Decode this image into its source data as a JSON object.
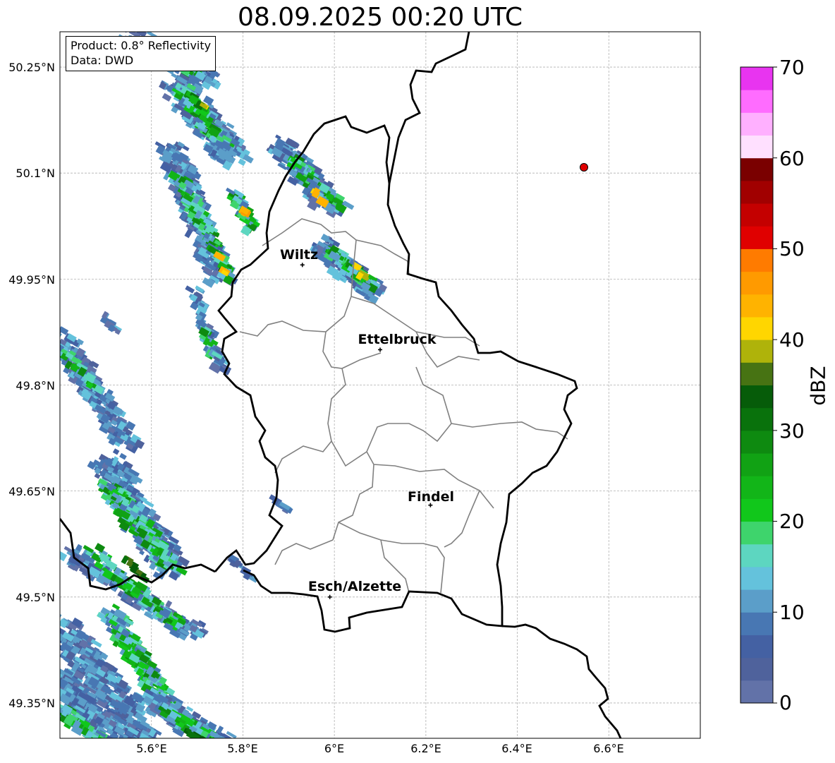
{
  "title": "08.09.2025 00:20 UTC",
  "info": {
    "product": "Product: 0.8° Reflectivity",
    "data": "Data: DWD"
  },
  "map": {
    "extent_lon": [
      5.4,
      6.8
    ],
    "extent_lat": [
      49.3,
      50.3
    ],
    "lat_ticks": [
      "50.25°N",
      "50.1°N",
      "49.95°N",
      "49.8°N",
      "49.65°N",
      "49.5°N",
      "49.35°N"
    ],
    "lon_ticks": [
      "5.6°E",
      "5.8°E",
      "6°E",
      "6.2°E",
      "6.4°E",
      "6.6°E"
    ],
    "radar_site_color": "#e00000",
    "cities": [
      {
        "name": "Wiltz",
        "lon": 5.93,
        "lat": 49.97
      },
      {
        "name": "Ettelbruck",
        "lon": 6.1,
        "lat": 49.85
      },
      {
        "name": "Findel",
        "lon": 6.21,
        "lat": 49.63
      },
      {
        "name": "Esch/Alzette",
        "lon": 5.99,
        "lat": 49.5
      }
    ]
  },
  "colorbar": {
    "label": "dBZ",
    "ticks": [
      "0",
      "10",
      "20",
      "30",
      "40",
      "50",
      "60",
      "70"
    ],
    "min": 0,
    "max": 70,
    "step": 2.5,
    "colors": [
      "#6272a8",
      "#4f629c",
      "#4461a3",
      "#4877b3",
      "#5b9ec9",
      "#64c2dc",
      "#5dd6c0",
      "#3ed46c",
      "#11c71b",
      "#12b518",
      "#11a214",
      "#0e8a10",
      "#09720c",
      "#065c09",
      "#477313",
      "#afb30a",
      "#ffd600",
      "#ffb300",
      "#ff9a00",
      "#ff7b00",
      "#e00000",
      "#c40000",
      "#a10000",
      "#7a0000",
      "#ffe0ff",
      "#ffb0ff",
      "#ff6cff",
      "#e834f0"
    ]
  }
}
